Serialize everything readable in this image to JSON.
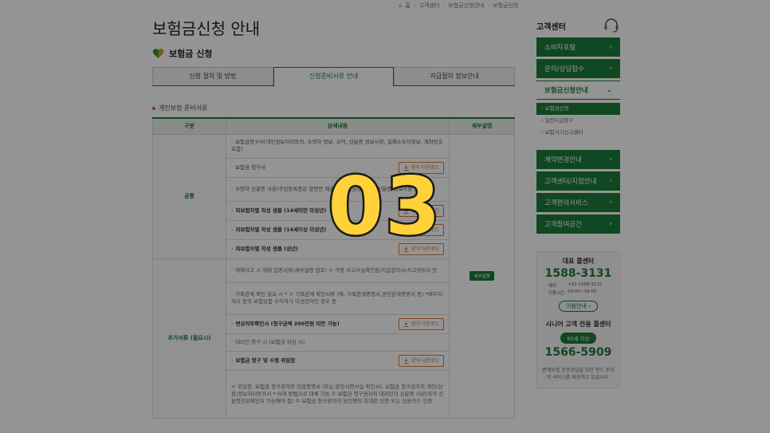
{
  "breadcrumb": [
    "홈",
    "고객센터",
    "보험금신청안내",
    "보험금신청"
  ],
  "page_title": "보험금신청 안내",
  "section_title": "보험금 신청",
  "tabs": [
    {
      "label": "신청 절차 및 방법",
      "active": false
    },
    {
      "label": "신청준비서류 안내",
      "active": true
    },
    {
      "label": "지급절차 정보안내",
      "active": false
    }
  ],
  "sub_heading": "개인보험 준비서류",
  "table": {
    "headers": [
      "구분",
      "상세내용",
      "세부설명"
    ],
    "common_label": "공통",
    "extra_label": "추가서류 (필요시)",
    "extra_button": "세부설명",
    "common_rows": [
      {
        "text": "보험금청구서(개인정보처리동의, 수령자 정보, 국적, 신분증 정보사항, 실제소유자정보, 계좌번호 포함)",
        "bold": false,
        "button": ""
      },
      {
        "text": "보험금 청구서",
        "bold": false,
        "button": "양식 다운로드"
      },
      {
        "text": "수령자 신분증 사본(주민등록증은 앞면만 제출) * 보험금청구서에 신분증 정보사항 입력시",
        "bold": false,
        "button": ""
      },
      {
        "text": "피보험자별 작성 샘플 (14세미만 미성년)",
        "bold": true,
        "button": "양식 다운로드"
      },
      {
        "text": "피보험자별 작성 샘플 (14세이상 미성년)",
        "bold": true,
        "button": "양식 다운로드"
      },
      {
        "text": "피보험자별 작성 샘플 (성년)",
        "bold": true,
        "button": "양식 다운로드"
      }
    ],
    "extra_rows": [
      {
        "text": "재해사고 시 재해 입증서류(세부설명 참조) ㅇ 각종 사고사실확인원/치급결의서/사고경위서 등",
        "bold": false,
        "button": ""
      },
      {
        "text": "가족관계 확인 필요 시 * ㅇ 가족관계 확인서류 (예. 가족관계증명서,혼인관계증명서 등) *배우자,자녀 등의 보험상품 수익자가 미성년자인 경우 등",
        "bold": false,
        "button": ""
      },
      {
        "text": "변상의무확인서 (청구금액 200만원 미만 가능)",
        "bold": true,
        "button": "양식 다운로드"
      },
      {
        "text": "대리인 청구 시 (보험금 위임 시)",
        "bold": false,
        "button": ""
      },
      {
        "text": "보험금 청구 및 수령 위임장",
        "bold": true,
        "button": "양식 다운로드"
      },
      {
        "text": "ㅇ 위임장, 보험금 청구권자의 인감증명서 (또는 본인서명사실 확인서), 보험금 청구권자의 개인(신용)정보처리동의서 * 아래 방법으로 대체 가능 ① 보험금 청구권자와 대리인의 신분증 사본(직각 신분증진위확인이 가능해야 함) ② 보험금 청구권자의 본인명의 휴대폰 인증 또는 신용카드 인증",
        "bold": false,
        "button": ""
      }
    ]
  },
  "sidebar": {
    "title": "고객센터",
    "menu": [
      {
        "label": "소비자포털",
        "state": "closed"
      },
      {
        "label": "문의/상담접수",
        "state": "closed"
      },
      {
        "label": "보험금신청안내",
        "state": "open"
      }
    ],
    "submenu": [
      {
        "label": "보험금신청",
        "on": true
      },
      {
        "label": "일반지급청구",
        "on": false
      },
      {
        "label": "보험사기신고센터",
        "on": false
      }
    ],
    "menu2": [
      {
        "label": "계약변경안내"
      },
      {
        "label": "고객센터/지점안내"
      },
      {
        "label": "고객편의서비스"
      },
      {
        "label": "고객참여공간"
      }
    ],
    "call": {
      "label": "대표 콜센터",
      "number": "1588-3131",
      "overseas_label": "해외",
      "overseas_number": "+82-1588-3131",
      "hours_label": "이용시간",
      "hours": "09:00~18:00",
      "guide": "이용안내"
    },
    "senior": {
      "title": "시니어 고객 전용 콜센터",
      "badge": "65세 이상",
      "number": "1566-5909"
    },
    "note": "변액보험 전용상담을 위한 펀드 주치의 서비스를 제공하고 있습니다."
  },
  "overlay_number": "03",
  "colors": {
    "brand_green": "#1a7a3a",
    "accent_orange": "#e07a30",
    "overlay_yellow": "#ffd23a"
  }
}
